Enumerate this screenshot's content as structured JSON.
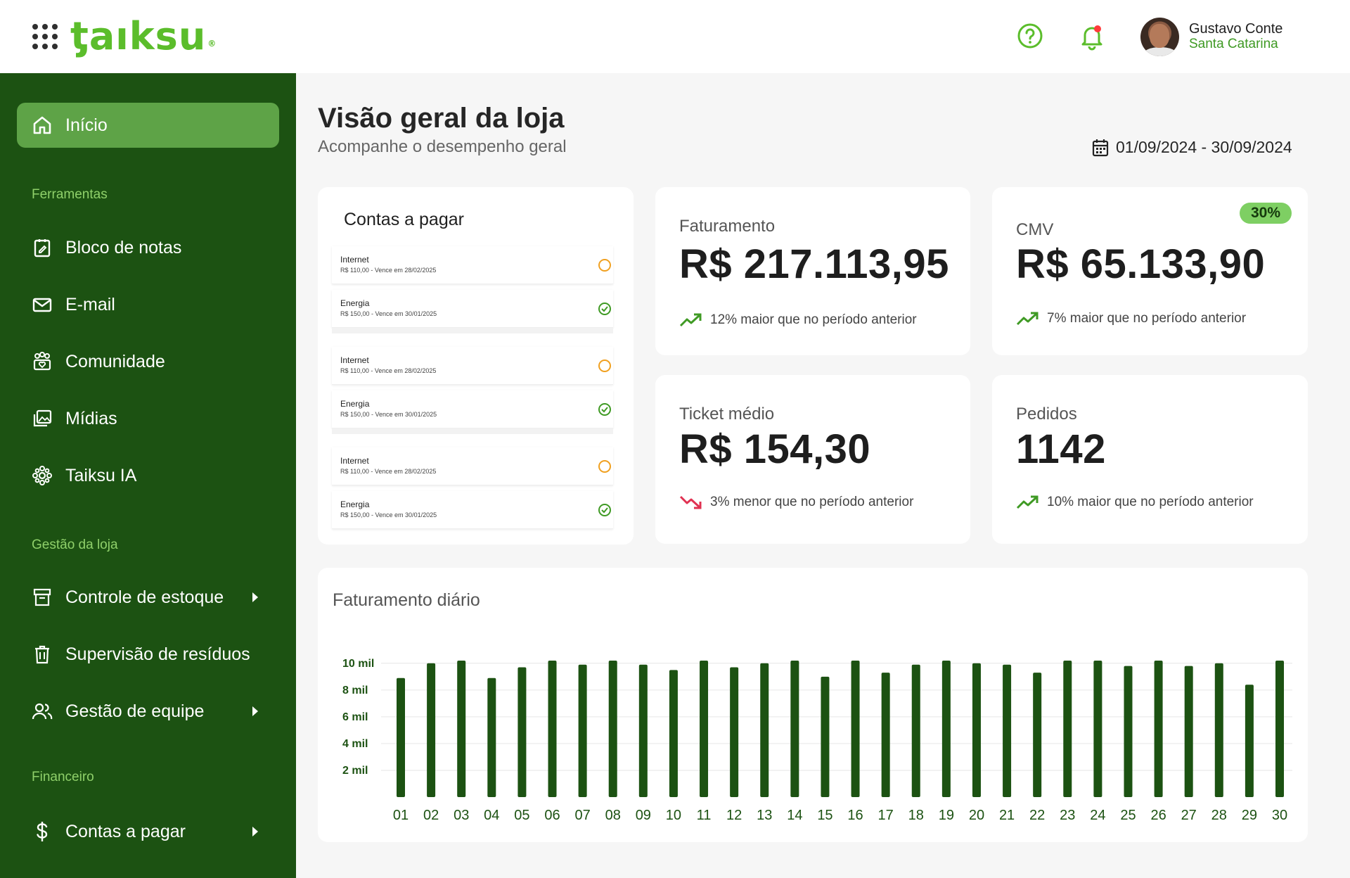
{
  "brand": {
    "logo_text": "ƫaıksu",
    "registered": "®"
  },
  "header": {
    "icons": {
      "apps": "apps-grid-icon",
      "help": "help-icon",
      "notifications": "bell-icon"
    },
    "notification_dot_color": "#ff3b3b",
    "user": {
      "name": "Gustavo Conte",
      "location": "Santa Catarina"
    }
  },
  "sidebar": {
    "active": {
      "label": "Início",
      "icon": "home-icon"
    },
    "sections": [
      {
        "label": "Ferramentas"
      },
      {
        "label": "Gestão da loja"
      },
      {
        "label": "Financeiro"
      }
    ],
    "items": [
      {
        "label": "Bloco de notas",
        "icon": "notepad-icon"
      },
      {
        "label": "E-mail",
        "icon": "mail-icon"
      },
      {
        "label": "Comunidade",
        "icon": "community-icon"
      },
      {
        "label": "Mídias",
        "icon": "media-icon"
      },
      {
        "label": "Taiksu IA",
        "icon": "ai-icon"
      },
      {
        "label": "Controle de estoque",
        "icon": "archive-icon",
        "expandable": true
      },
      {
        "label": "Supervisão de resíduos",
        "icon": "trash-icon"
      },
      {
        "label": "Gestão de equipe",
        "icon": "team-icon",
        "expandable": true
      },
      {
        "label": "Contas a pagar",
        "icon": "dollar-icon",
        "expandable": true
      }
    ]
  },
  "page": {
    "title": "Visão geral da loja",
    "subtitle": "Acompanhe o desempenho geral",
    "date_range": "01/09/2024 - 30/09/2024"
  },
  "bills": {
    "title": "Contas a pagar",
    "items": [
      {
        "name": "Internet",
        "desc": "R$ 110,00 - Vence em 28/02/2025",
        "status": "pending"
      },
      {
        "name": "Energia",
        "desc": "R$ 150,00 - Vence em 30/01/2025",
        "status": "paid"
      },
      {
        "name": "Internet",
        "desc": "R$ 110,00 - Vence em 28/02/2025",
        "status": "pending"
      },
      {
        "name": "Energia",
        "desc": "R$ 150,00 - Vence em 30/01/2025",
        "status": "paid"
      },
      {
        "name": "Internet",
        "desc": "R$ 110,00 - Vence em 28/02/2025",
        "status": "pending"
      },
      {
        "name": "Energia",
        "desc": "R$ 150,00 - Vence em 30/01/2025",
        "status": "paid"
      }
    ]
  },
  "metrics": {
    "faturamento": {
      "label": "Faturamento",
      "value": "R$ 217.113,95",
      "trend": "12% maior que no período anterior",
      "direction": "up"
    },
    "cmv": {
      "label": "CMV",
      "value": "R$ 65.133,90",
      "badge": "30%",
      "trend": "7% maior que no período anterior",
      "direction": "up"
    },
    "ticket": {
      "label": "Ticket médio",
      "value": "R$ 154,30",
      "trend": "3% menor que no período anterior",
      "direction": "down"
    },
    "pedidos": {
      "label": "Pedidos",
      "value": "1142",
      "trend": "10% maior que no período anterior",
      "direction": "up"
    }
  },
  "colors": {
    "accent": "#5bbd2b",
    "sidebar": "#1c5212",
    "active": "#5ea347",
    "bar": "#1c5212",
    "up": "#3f9a24",
    "down": "#e03151",
    "pending": "#f0a020",
    "paid": "#3f9a24"
  },
  "chart_data": {
    "type": "bar",
    "title": "Faturamento diário",
    "categories": [
      "01",
      "02",
      "03",
      "04",
      "05",
      "06",
      "07",
      "08",
      "09",
      "10",
      "11",
      "12",
      "13",
      "14",
      "15",
      "16",
      "17",
      "18",
      "19",
      "20",
      "21",
      "22",
      "23",
      "24",
      "25",
      "26",
      "27",
      "28",
      "29",
      "30"
    ],
    "values": [
      8900,
      10000,
      10200,
      8900,
      9700,
      10200,
      9900,
      10200,
      9900,
      9500,
      10200,
      9700,
      10000,
      10200,
      9000,
      10200,
      9300,
      9900,
      10200,
      10000,
      9900,
      9300,
      10200,
      10200,
      9800,
      10200,
      9800,
      10000,
      8400,
      10200
    ],
    "yticks": [
      2000,
      4000,
      6000,
      8000,
      10000
    ],
    "ytick_labels": [
      "2 mil",
      "4 mil",
      "6 mil",
      "8 mil",
      "10 mil"
    ],
    "ylim": [
      0,
      10500
    ],
    "grid": true,
    "xlabel": "",
    "ylabel": ""
  }
}
